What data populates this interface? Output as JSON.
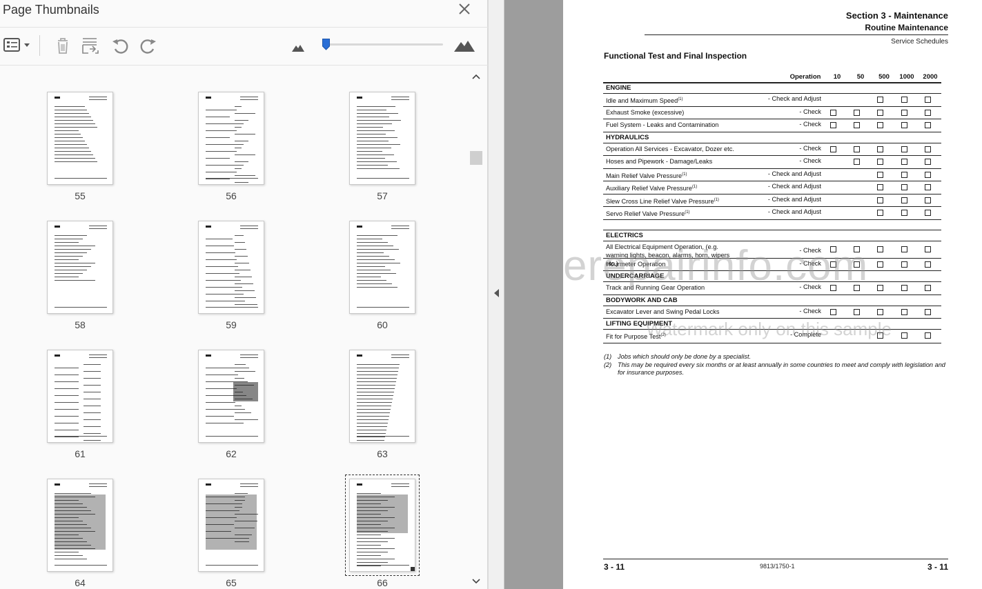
{
  "panel": {
    "title": "Page Thumbnails",
    "icons": [
      "options-menu-icon",
      "delete-icon",
      "extract-page-icon",
      "rotate-left-icon",
      "rotate-right-icon",
      "zoom-out-mountain-icon",
      "zoom-in-mountain-icon"
    ],
    "zoom_fraction": 0.05,
    "thumbnails": [
      {
        "label": "55"
      },
      {
        "label": "56"
      },
      {
        "label": "57"
      },
      {
        "label": "58"
      },
      {
        "label": "59"
      },
      {
        "label": "60"
      },
      {
        "label": "61"
      },
      {
        "label": "62"
      },
      {
        "label": "63"
      },
      {
        "label": "64"
      },
      {
        "label": "65"
      },
      {
        "label": "66",
        "selected": true
      }
    ]
  },
  "document": {
    "section": "Section 3 - Maintenance",
    "subsection": "Routine Maintenance",
    "schedule": "Service Schedules",
    "title": "Functional Test and Final Inspection",
    "columns": [
      "Operation",
      "10",
      "50",
      "500",
      "1000",
      "2000"
    ],
    "groups": [
      {
        "name": "ENGINE",
        "items": [
          {
            "label": "Idle and Maximum Speed",
            "sup": "(1)",
            "op": "- Check and Adjust",
            "checks": [
              false,
              false,
              true,
              true,
              true
            ]
          },
          {
            "label": "Exhaust Smoke (excessive)",
            "op": "- Check",
            "checks": [
              true,
              true,
              true,
              true,
              true
            ]
          },
          {
            "label": "Fuel System - Leaks and Contamination",
            "op": "- Check",
            "checks": [
              true,
              true,
              true,
              true,
              true
            ]
          }
        ]
      },
      {
        "name": "HYDRAULICS",
        "items": [
          {
            "label": "Operation All Services - Excavator, Dozer etc.",
            "op": "- Check",
            "checks": [
              true,
              true,
              true,
              true,
              true
            ]
          },
          {
            "label": "Hoses and Pipework - Damage/Leaks",
            "op": "- Check",
            "checks": [
              false,
              true,
              true,
              true,
              true
            ]
          },
          {
            "label": "Main Relief Valve Pressure",
            "sup": "(1)",
            "op": "- Check and Adjust",
            "checks": [
              false,
              false,
              true,
              true,
              true
            ]
          },
          {
            "label": "Auxiliary Relief Valve Pressure",
            "sup": "(1)",
            "op": "- Check and Adjust",
            "checks": [
              false,
              false,
              true,
              true,
              true
            ]
          },
          {
            "label": "Slew Cross Line Relief Valve Pressure",
            "sup": "(1)",
            "op": "- Check and Adjust",
            "checks": [
              false,
              false,
              true,
              true,
              true
            ]
          },
          {
            "label": "Servo Relief Valve Pressure",
            "sup": "(1)",
            "op": "- Check and Adjust",
            "checks": [
              false,
              false,
              true,
              true,
              true
            ]
          }
        ]
      },
      {
        "name": "ELECTRICS",
        "items": [
          {
            "label": "All Electrical Equipment Operation, (e.g. warning lights, beacon, alarms, horn, wipers etc.)",
            "op": "- Check",
            "checks": [
              true,
              true,
              true,
              true,
              true
            ]
          },
          {
            "label": "Hourmeter Operation",
            "op": "- Check",
            "checks": [
              true,
              true,
              true,
              true,
              true
            ]
          }
        ]
      },
      {
        "name": "UNDERCARRIAGE",
        "items": [
          {
            "label": "Track and Running Gear Operation",
            "op": "- Check",
            "checks": [
              true,
              true,
              true,
              true,
              true
            ]
          }
        ]
      },
      {
        "name": "BODYWORK AND CAB",
        "items": [
          {
            "label": "Excavator Lever and Swing Pedal Locks",
            "op": "- Check",
            "checks": [
              true,
              true,
              true,
              true,
              true
            ]
          }
        ]
      },
      {
        "name": "LIFTING EQUIPMENT",
        "items": [
          {
            "label": "Fit for Purpose Test",
            "sup": "(2)",
            "op": "- Complete",
            "checks": [
              false,
              false,
              true,
              true,
              true
            ]
          }
        ]
      }
    ],
    "footnotes": [
      {
        "num": "(1)",
        "text": "Jobs which should only be done by a specialist."
      },
      {
        "num": "(2)",
        "text": "This may be required every six months or at least annually in some countries to meet and comply with legislation and for insurance purposes."
      }
    ],
    "footer_left": "3 - 11",
    "footer_mid": "9813/1750-1",
    "footer_right": "3 - 11",
    "watermark_main": "erepairinfo.com",
    "watermark_sub": "Watermark only on this sample"
  }
}
